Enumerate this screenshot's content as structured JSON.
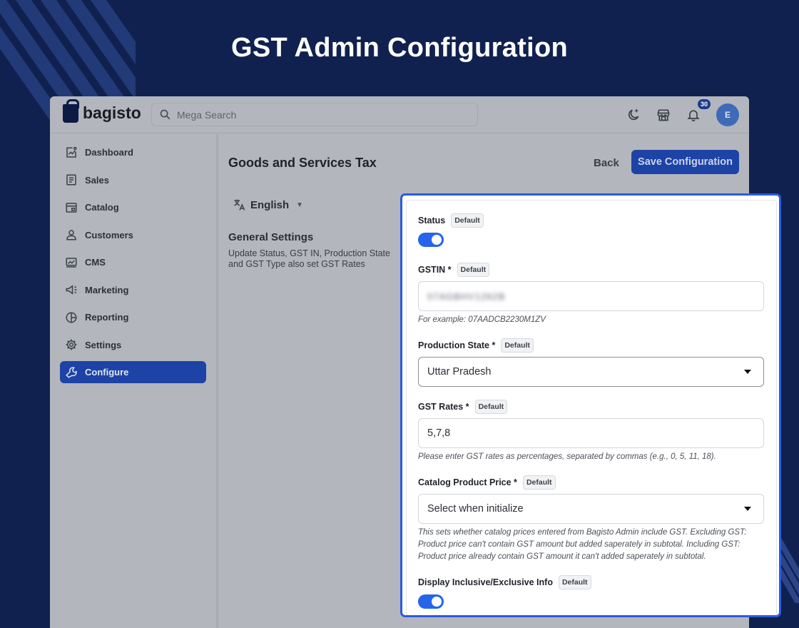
{
  "headline": "GST Admin Configuration",
  "brand": {
    "name": "bagisto"
  },
  "search": {
    "placeholder": "Mega Search"
  },
  "topbar": {
    "icons": [
      "moon-icon",
      "store-icon",
      "bell-icon"
    ],
    "notification_count": "30",
    "avatar_initial": "E"
  },
  "sidebar": {
    "items": [
      {
        "label": "Dashboard",
        "icon": "dashboard-icon",
        "active": false
      },
      {
        "label": "Sales",
        "icon": "receipt-icon",
        "active": false
      },
      {
        "label": "Catalog",
        "icon": "catalog-icon",
        "active": false
      },
      {
        "label": "Customers",
        "icon": "user-icon",
        "active": false
      },
      {
        "label": "CMS",
        "icon": "monitor-icon",
        "active": false
      },
      {
        "label": "Marketing",
        "icon": "megaphone-icon",
        "active": false
      },
      {
        "label": "Reporting",
        "icon": "pie-chart-icon",
        "active": false
      },
      {
        "label": "Settings",
        "icon": "gear-icon",
        "active": false
      },
      {
        "label": "Configure",
        "icon": "wrench-icon",
        "active": true
      }
    ]
  },
  "main": {
    "title": "Goods and Services Tax",
    "back_label": "Back",
    "save_label": "Save Configuration",
    "language": "English",
    "section_title": "General Settings",
    "section_desc": "Update Status, GST IN, Production State and GST Type also set GST Rates"
  },
  "form": {
    "default_tag": "Default",
    "status": {
      "label": "Status",
      "enabled": true
    },
    "gstin": {
      "label": "GSTIN *",
      "value": "07AGBHV1262B",
      "hint": "For example: 07AADCB2230M1ZV"
    },
    "production_state": {
      "label": "Production State *",
      "value": "Uttar Pradesh"
    },
    "gst_rates": {
      "label": "GST Rates *",
      "value": "5,7,8",
      "hint": "Please enter GST rates as percentages, separated by commas (e.g., 0, 5, 11, 18)."
    },
    "catalog_price": {
      "label": "Catalog Product Price *",
      "value": "Select when initialize",
      "hint": "This sets whether catalog prices entered from Bagisto Admin include GST. Excluding GST: Product price can't contain GST amount but added saperately in subtotal. Including GST: Product price already contain GST amount it can't added saperately in subtotal."
    },
    "display_info": {
      "label": "Display Inclusive/Exclusive Info",
      "enabled": true
    }
  },
  "colors": {
    "background": "#10214f",
    "accent": "#1e43a6",
    "toggle_on": "#2564eb",
    "highlight_border": "#2b5be0"
  }
}
